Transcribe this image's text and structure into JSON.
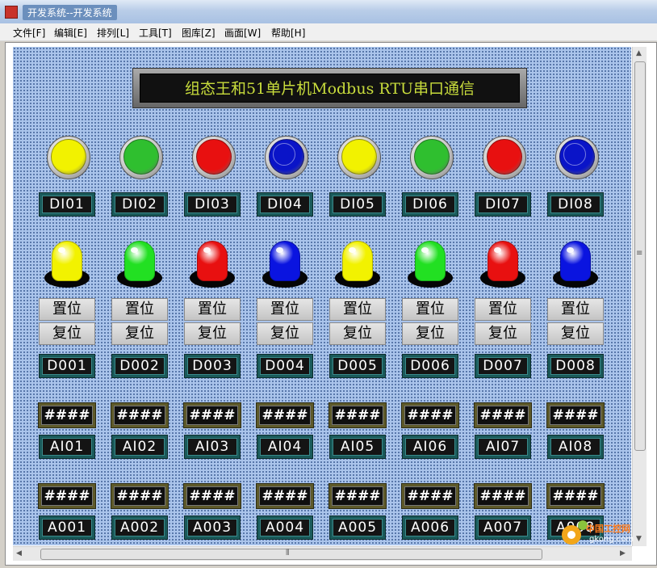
{
  "window": {
    "title": "开发系统--开发系统"
  },
  "menu": [
    {
      "label": "文件[F]"
    },
    {
      "label": "编辑[E]"
    },
    {
      "label": "排列[L]"
    },
    {
      "label": "工具[T]"
    },
    {
      "label": "图库[Z]"
    },
    {
      "label": "画面[W]"
    },
    {
      "label": "帮助[H]"
    }
  ],
  "banner": {
    "text": "组态王和51单片机Modbus RTU串口通信"
  },
  "di": [
    {
      "label": "DI01",
      "color": "#f2f200"
    },
    {
      "label": "DI02",
      "color": "#2fbf2f"
    },
    {
      "label": "DI03",
      "color": "#e81010"
    },
    {
      "label": "DI04",
      "color": "#0a14c8"
    },
    {
      "label": "DI05",
      "color": "#f2f200"
    },
    {
      "label": "DI06",
      "color": "#2fbf2f"
    },
    {
      "label": "DI07",
      "color": "#e81010"
    },
    {
      "label": "DI08",
      "color": "#0a14c8"
    }
  ],
  "do_lamps": [
    "#f2f200",
    "#22e022",
    "#e81010",
    "#0a14e0",
    "#f2f200",
    "#22e022",
    "#e81010",
    "#0a14e0"
  ],
  "do": [
    {
      "label": "D001",
      "set": "置位",
      "reset": "复位"
    },
    {
      "label": "D002",
      "set": "置位",
      "reset": "复位"
    },
    {
      "label": "D003",
      "set": "置位",
      "reset": "复位"
    },
    {
      "label": "D004",
      "set": "置位",
      "reset": "复位"
    },
    {
      "label": "D005",
      "set": "置位",
      "reset": "复位"
    },
    {
      "label": "D006",
      "set": "置位",
      "reset": "复位"
    },
    {
      "label": "D007",
      "set": "置位",
      "reset": "复位"
    },
    {
      "label": "D008",
      "set": "置位",
      "reset": "复位"
    }
  ],
  "ai": [
    {
      "label": "AI01",
      "value": "####"
    },
    {
      "label": "AI02",
      "value": "####"
    },
    {
      "label": "AI03",
      "value": "####"
    },
    {
      "label": "AI04",
      "value": "####"
    },
    {
      "label": "AI05",
      "value": "####"
    },
    {
      "label": "AI06",
      "value": "####"
    },
    {
      "label": "AI07",
      "value": "####"
    },
    {
      "label": "AI08",
      "value": "####"
    }
  ],
  "ao": [
    {
      "label": "A001",
      "value": "####"
    },
    {
      "label": "A002",
      "value": "####"
    },
    {
      "label": "A003",
      "value": "####"
    },
    {
      "label": "A004",
      "value": "####"
    },
    {
      "label": "A005",
      "value": "####"
    },
    {
      "label": "A006",
      "value": "####"
    },
    {
      "label": "A007",
      "value": "####"
    },
    {
      "label": "A008",
      "value": "####"
    }
  ],
  "watermark": {
    "brand": "中国工控网",
    "url": "gkong.com"
  }
}
